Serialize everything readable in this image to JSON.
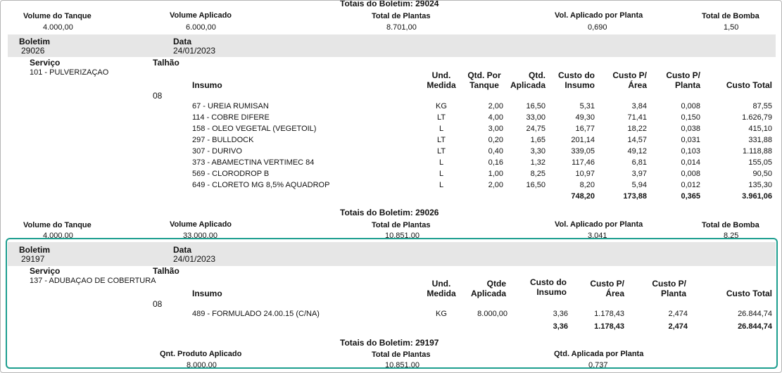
{
  "summary1": {
    "title": "Totais do Boletim: 29024",
    "labels": [
      "Volume do Tanque",
      "Volume Aplicado",
      "Total de Plantas",
      "Vol. Aplicado por Planta",
      "Total de Bomba"
    ],
    "values": [
      "4.000,00",
      "6.000,00",
      "8.701,00",
      "0,690",
      "1,50"
    ]
  },
  "boletim1": {
    "label_boletim": "Boletim",
    "label_data": "Data",
    "number": "29026",
    "date": "24/01/2023",
    "label_servico": "Serviço",
    "label_talhao": "Talhão",
    "servico": "101 - PULVERIZAÇAO",
    "talhao": "08",
    "headers": {
      "insumo": "Insumo",
      "und1": "Und.",
      "und2": "Medida",
      "qtdtanque1": "Qtd. Por",
      "qtdtanque2": "Tanque",
      "qtdapl1": "Qtd.",
      "qtdapl2": "Aplicada",
      "custoins1": "Custo do",
      "custoins2": "Insumo",
      "custoarea1": "Custo P/",
      "custoarea2": "Área",
      "custoplanta1": "Custo P/",
      "custoplanta2": "Planta",
      "custototal": "Custo Total"
    },
    "rows": [
      {
        "insumo": "67 - UREIA RUMISAN",
        "und": "KG",
        "tanque": "2,00",
        "aplicada": "16,50",
        "custo": "5,31",
        "area": "3,84",
        "planta": "0,008",
        "total": "87,55"
      },
      {
        "insumo": "114 - COBRE DIFERE",
        "und": "LT",
        "tanque": "4,00",
        "aplicada": "33,00",
        "custo": "49,30",
        "area": "71,41",
        "planta": "0,150",
        "total": "1.626,79"
      },
      {
        "insumo": "158 - OLEO VEGETAL (VEGETOIL)",
        "und": "L",
        "tanque": "3,00",
        "aplicada": "24,75",
        "custo": "16,77",
        "area": "18,22",
        "planta": "0,038",
        "total": "415,10"
      },
      {
        "insumo": "297 - BULLDOCK",
        "und": "LT",
        "tanque": "0,20",
        "aplicada": "1,65",
        "custo": "201,14",
        "area": "14,57",
        "planta": "0,031",
        "total": "331,88"
      },
      {
        "insumo": "307 - DURIVO",
        "und": "LT",
        "tanque": "0,40",
        "aplicada": "3,30",
        "custo": "339,05",
        "area": "49,12",
        "planta": "0,103",
        "total": "1.118,88"
      },
      {
        "insumo": "373 - ABAMECTINA VERTIMEC 84",
        "und": "L",
        "tanque": "0,16",
        "aplicada": "1,32",
        "custo": "117,46",
        "area": "6,81",
        "planta": "0,014",
        "total": "155,05"
      },
      {
        "insumo": "569 - CLORODROP B",
        "und": "L",
        "tanque": "1,00",
        "aplicada": "8,25",
        "custo": "10,97",
        "area": "3,97",
        "planta": "0,008",
        "total": "90,50"
      },
      {
        "insumo": "649 - CLORETO MG 8,5% AQUADROP",
        "und": "L",
        "tanque": "2,00",
        "aplicada": "16,50",
        "custo": "8,20",
        "area": "5,94",
        "planta": "0,012",
        "total": "135,30"
      }
    ],
    "totals": {
      "custo": "748,20",
      "area": "173,88",
      "planta": "0,365",
      "total": "3.961,06"
    }
  },
  "summary2": {
    "title": "Totais do Boletim: 29026",
    "labels": [
      "Volume do Tanque",
      "Volume Aplicado",
      "Total de Plantas",
      "Vol. Aplicado por Planta",
      "Total de Bomba"
    ],
    "values": [
      "4.000,00",
      "33.000,00",
      "10.851,00",
      "3,041",
      "8,25"
    ]
  },
  "boletim2": {
    "label_boletim": "Boletim",
    "label_data": "Data",
    "number": "29197",
    "date": "24/01/2023",
    "label_servico": "Serviço",
    "label_talhao": "Talhão",
    "servico": "137 - ADUBAÇAO DE COBERTURA",
    "talhao": "08",
    "headers": {
      "insumo": "Insumo",
      "und1": "Und.",
      "und2": "Medida",
      "qtdapl1": "Qtde",
      "qtdapl2": "Aplicada",
      "custoins1": "Custo do",
      "custoins2": "Insumo",
      "custoarea1": "Custo P/",
      "custoarea2": "Área",
      "custoplanta1": "Custo P/",
      "custoplanta2": "Planta",
      "custototal": "Custo Total"
    },
    "rows": [
      {
        "insumo": "489 - FORMULADO 24.00.15 (C/NA)",
        "und": "KG",
        "aplicada": "8.000,00",
        "custo": "3,36",
        "area": "1.178,43",
        "planta": "2,474",
        "total": "26.844,74"
      }
    ],
    "totals": {
      "custo": "3,36",
      "area": "1.178,43",
      "planta": "2,474",
      "total": "26.844,74"
    }
  },
  "summary3": {
    "title": "Totais do Boletim: 29197",
    "labels": [
      "Qnt. Produto Aplicado",
      "Total de Plantas",
      "Qtd. Aplicada por Planta"
    ],
    "values": [
      "8.000,00",
      "10.851,00",
      "0,737"
    ]
  }
}
